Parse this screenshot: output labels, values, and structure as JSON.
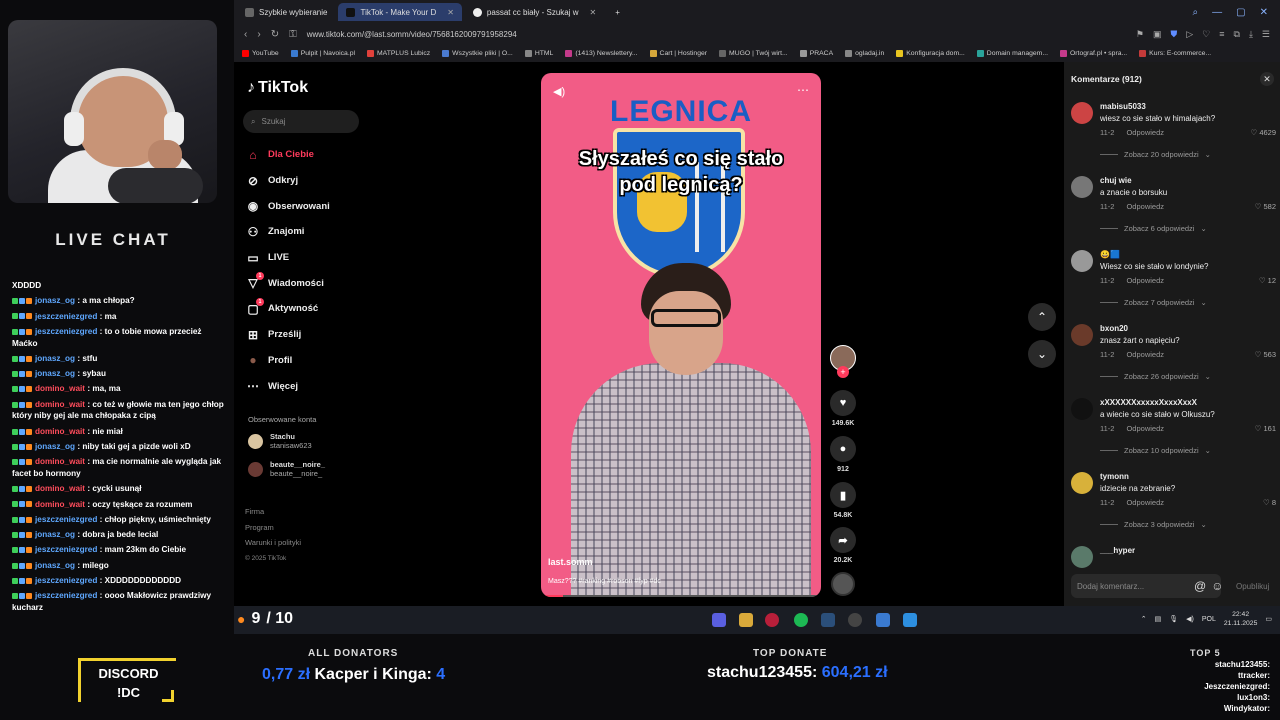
{
  "chat": {
    "title": "LIVE CHAT",
    "messages": [
      {
        "user": "",
        "text": "XDDDD",
        "red": false
      },
      {
        "user": "jonasz_og",
        "text": " : a ma chłopa?",
        "red": false
      },
      {
        "user": "jeszczeniezgred",
        "text": " : ma",
        "red": false
      },
      {
        "user": "jeszczeniezgred",
        "text": " : to o tobie mowa przecież Maćko",
        "red": false
      },
      {
        "user": "jonasz_og",
        "text": " : stfu",
        "red": false
      },
      {
        "user": "jonasz_og",
        "text": " : sybau",
        "red": false
      },
      {
        "user": "domino_wait",
        "text": " : ma, ma",
        "red": true
      },
      {
        "user": "domino_wait",
        "text": " : co też w głowie ma ten jego chłop który niby gej ale ma chłopaka z cipą",
        "red": true
      },
      {
        "user": "domino_wait",
        "text": " : nie miał",
        "red": true
      },
      {
        "user": "jonasz_og",
        "text": " : niby taki gej a pizde woli xD",
        "red": false
      },
      {
        "user": "domino_wait",
        "text": " : ma cie normalnie ale wygląda jak facet bo hormony",
        "red": true
      },
      {
        "user": "domino_wait",
        "text": " : cycki usunął",
        "red": true
      },
      {
        "user": "domino_wait",
        "text": " : oczy tęskące za rozumem",
        "red": true
      },
      {
        "user": "jeszczeniezgred",
        "text": " : chłop piękny, uśmiechnięty",
        "red": false
      },
      {
        "user": "jonasz_og",
        "text": " : dobra ja bede lecial",
        "red": false
      },
      {
        "user": "jeszczeniezgred",
        "text": " : mam 23km do Ciebie",
        "red": false
      },
      {
        "user": "jonasz_og",
        "text": " : milego",
        "red": false
      },
      {
        "user": "jeszczeniezgred",
        "text": " : XDDDDDDDDDDDD",
        "red": false
      },
      {
        "user": "jeszczeniezgred",
        "text": " : oooo Makłowicz prawdziwy kucharz",
        "red": false
      }
    ]
  },
  "browser": {
    "tabs": [
      {
        "label": "Szybkie wybieranie",
        "active": false
      },
      {
        "label": "TikTok - Make Your D",
        "active": true
      },
      {
        "label": "passat cc biały - Szukaj w",
        "active": false
      }
    ],
    "new_tab": "+",
    "url": "www.tiktok.com/@last.somm/video/7568162009791958294",
    "bookmarks": [
      "YouTube",
      "Pulpit | Navoica.pl",
      "MATPLUS Lubicz",
      "Wszystkie pliki | O...",
      "HTML",
      "(1413) Newslettery...",
      "Cart | Hostinger",
      "MUGO | Twój wirt...",
      "PRACA",
      "ogladaj.in",
      "Konfiguracja dom...",
      "Domain managem...",
      "Ortograf.pl • spra...",
      "Kurs: E-commerce..."
    ]
  },
  "tiktok": {
    "logo": "TikTok",
    "search_placeholder": "Szukaj",
    "nav": [
      {
        "label": "Dla Ciebie",
        "icon": "home-icon",
        "active": true,
        "badge": ""
      },
      {
        "label": "Odkryj",
        "icon": "compass-icon",
        "active": false,
        "badge": ""
      },
      {
        "label": "Obserwowani",
        "icon": "following-icon",
        "active": false,
        "badge": ""
      },
      {
        "label": "Znajomi",
        "icon": "friends-icon",
        "active": false,
        "badge": ""
      },
      {
        "label": "LIVE",
        "icon": "live-icon",
        "active": false,
        "badge": ""
      },
      {
        "label": "Wiadomości",
        "icon": "messages-icon",
        "active": false,
        "badge": "1"
      },
      {
        "label": "Aktywność",
        "icon": "activity-icon",
        "active": false,
        "badge": "1"
      },
      {
        "label": "Prześlij",
        "icon": "upload-icon",
        "active": false,
        "badge": ""
      },
      {
        "label": "Profil",
        "icon": "profile-icon",
        "active": false,
        "badge": ""
      },
      {
        "label": "Więcej",
        "icon": "more-icon",
        "active": false,
        "badge": ""
      }
    ],
    "followed_title": "Obserwowane konta",
    "followed": [
      {
        "name": "Stachu",
        "handle": "stanisaw623"
      },
      {
        "name": "beaute__noire_",
        "handle": "beaute__noire_"
      }
    ],
    "footer": [
      "Firma",
      "Program",
      "Warunki i polityki",
      "© 2025 TikTok"
    ],
    "video": {
      "overlay_title": "LEGNICA",
      "caption": "Słyszałeś co się stało pod legnicą?",
      "username": "last.somm",
      "description": "Masz??? #ranking #robson #fyp #dc",
      "progress": 0.08
    },
    "actions": {
      "likes": "149.6K",
      "comments": "912",
      "saves": "54.8K",
      "shares": "20.2K",
      "follow": "+"
    }
  },
  "comments": {
    "title": "Komentarze (912)",
    "items": [
      {
        "user": "mabisu5033",
        "text": "wiesz co sie stało w himalajach?",
        "date": "11-2",
        "reply": "Odpowiedz",
        "likes": "4629",
        "more": "Zobacz 20 odpowiedzi",
        "color": "#c44"
      },
      {
        "user": "chuj wie",
        "text": "a znacie o borsuku",
        "date": "11-2",
        "reply": "Odpowiedz",
        "likes": "582",
        "more": "Zobacz 6 odpowiedzi",
        "color": "#777"
      },
      {
        "user": "😀🟦",
        "text": "Wiesz co sie stało w londynie?",
        "date": "11-2",
        "reply": "Odpowiedz",
        "likes": "12",
        "more": "Zobacz 7 odpowiedzi",
        "color": "#999"
      },
      {
        "user": "bxon20",
        "text": "znasz żart o napięciu?",
        "date": "11-2",
        "reply": "Odpowiedz",
        "likes": "563",
        "more": "Zobacz 26 odpowiedzi",
        "color": "#6a3a2a"
      },
      {
        "user": "xXXXXXXxxxxxXxxxXxxX",
        "text": "a wiecie co sie stało w Olkuszu?",
        "date": "11-2",
        "reply": "Odpowiedz",
        "likes": "161",
        "more": "Zobacz 10 odpowiedzi",
        "color": "#111"
      },
      {
        "user": "tymonn",
        "text": "idziecie na zebranie?",
        "date": "11-2",
        "reply": "Odpowiedz",
        "likes": "8",
        "more": "Zobacz 3 odpowiedzi",
        "color": "#d8b13a"
      },
      {
        "user": "___hyper",
        "text": "",
        "date": "",
        "reply": "",
        "likes": "",
        "more": "",
        "color": "#5a7a6a"
      }
    ],
    "input_placeholder": "Dodaj komentarz...",
    "post": "Opublikuj"
  },
  "taskbar": {
    "score": "9",
    "score_total": "/ 10",
    "lang": "POL",
    "time": "22:42",
    "date": "21.11.2025"
  },
  "overlay": {
    "discord_line1": "DISCORD",
    "discord_line2": "!DC",
    "all_donators_title": "ALL DONATORS",
    "all_donators_amount": "0,77 zł",
    "all_donators_name": "Kacper i Kinga:",
    "all_donators_trail": "4",
    "top_donate_title": "TOP DONATE",
    "top_donate_name": "stachu123455:",
    "top_donate_amount": "604,21 zł",
    "top5_title": "TOP 5",
    "top5": [
      "stachu123455:",
      "ttracker:",
      "Jeszczeniezgred:",
      "lux1on3:",
      "Windykator:"
    ]
  }
}
